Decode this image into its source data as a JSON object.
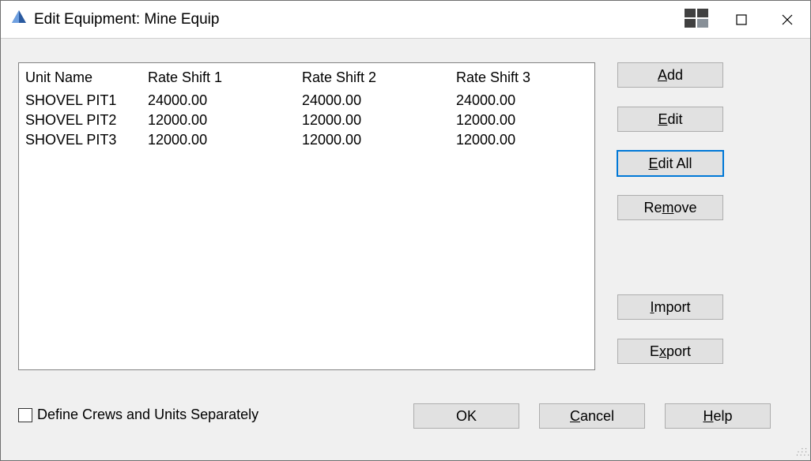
{
  "title": "Edit Equipment: Mine Equip",
  "table": {
    "headers": [
      "Unit Name",
      "Rate Shift 1",
      "Rate Shift 2",
      "Rate Shift 3"
    ],
    "rows": [
      {
        "c0": "SHOVEL PIT1",
        "c1": "24000.00",
        "c2": "24000.00",
        "c3": "24000.00"
      },
      {
        "c0": "SHOVEL PIT2",
        "c1": "12000.00",
        "c2": "12000.00",
        "c3": "12000.00"
      },
      {
        "c0": "SHOVEL PIT3",
        "c1": "12000.00",
        "c2": "12000.00",
        "c3": "12000.00"
      }
    ]
  },
  "buttons": {
    "add_pre": "",
    "add_ul": "A",
    "add_post": "dd",
    "edit_pre": "",
    "edit_ul": "E",
    "edit_post": "dit",
    "editall_pre": "",
    "editall_ul": "E",
    "editall_post": "dit All",
    "remove_pre": "Re",
    "remove_ul": "m",
    "remove_post": "ove",
    "import_pre": "",
    "import_ul": "I",
    "import_post": "mport",
    "export_pre": "E",
    "export_ul": "x",
    "export_post": "port",
    "ok": "OK",
    "cancel_pre": "",
    "cancel_ul": "C",
    "cancel_post": "ancel",
    "help_pre": "",
    "help_ul": "H",
    "help_post": "elp"
  },
  "checkbox_label": "Define Crews and Units Separately"
}
